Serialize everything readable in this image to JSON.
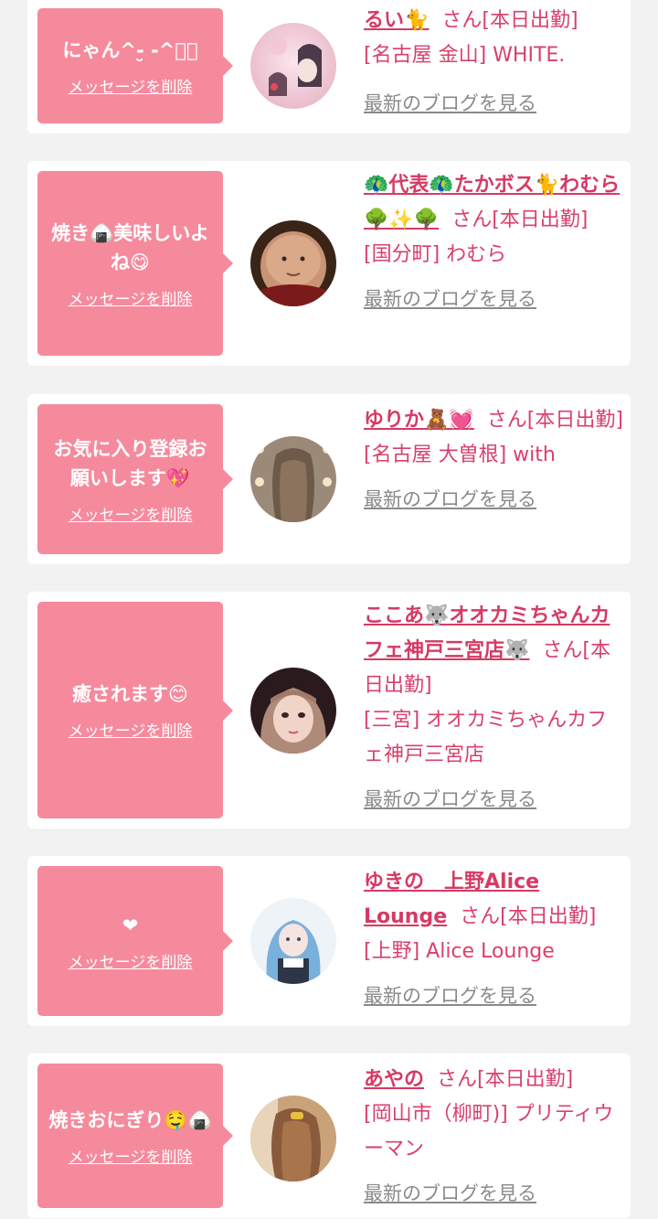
{
  "cards": [
    {
      "message": "にゃん^-̮ -^ฅ゙",
      "delete_label": "メッセージを削除",
      "name": "るい🐈",
      "status": "さん[本日出勤]",
      "shop": "[名古屋 金山] WHITE.",
      "blog_label": "最新のブログを見る"
    },
    {
      "message": "焼き🍙美味しいよね😋",
      "delete_label": "メッセージを削除",
      "name": "🦚代表🦚たかボス🐈わむら🌳✨🌳",
      "status": "さん[本日出勤]",
      "shop": "[国分町] わむら",
      "blog_label": "最新のブログを見る"
    },
    {
      "message": "お気に入り登録お願いします💖",
      "delete_label": "メッセージを削除",
      "name": "ゆりか🧸💓",
      "status": "さん[本日出勤]",
      "shop": "[名古屋 大曽根] with",
      "blog_label": "最新のブログを見る"
    },
    {
      "message": "癒されます😊",
      "delete_label": "メッセージを削除",
      "name": "ここあ🐺オオカミちゃんカフェ神戸三宮店🐺",
      "status": "さん[本日出勤]",
      "shop": "[三宮] オオカミちゃんカフェ神戸三宮店",
      "blog_label": "最新のブログを見る"
    },
    {
      "message": "❤",
      "delete_label": "メッセージを削除",
      "name": "ゆきの　上野Alice Lounge",
      "status": "さん[本日出勤]",
      "shop": "[上野] Alice Lounge",
      "blog_label": "最新のブログを見る"
    },
    {
      "message": "焼きおにぎり🤤🍙",
      "delete_label": "メッセージを削除",
      "name": "あやの",
      "status": "さん[本日出勤]",
      "shop": "[岡山市（柳町)] プリティウーマン",
      "blog_label": "最新のブログを見る"
    }
  ],
  "colors": {
    "bubble": "#f68a9d",
    "name": "#d63a64",
    "text": "#d9406a",
    "link_gray": "#8a8a8a",
    "background": "#f2f2f2"
  }
}
